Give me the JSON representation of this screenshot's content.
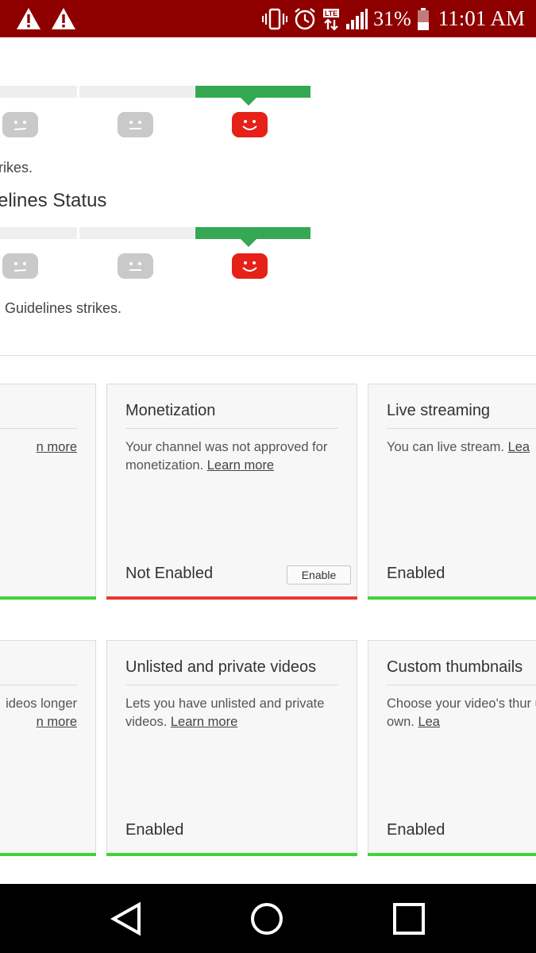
{
  "status_bar": {
    "icons": [
      "warning-icon",
      "warning-icon",
      "vibrate-icon",
      "alarm-icon",
      "lte-icon",
      "signal-icon",
      "battery-icon"
    ],
    "battery": "31%",
    "time": "11:01 AM",
    "background": "#8e0000"
  },
  "strikes": {
    "copyright_caption": "rikes.",
    "guidelines_title": "elines Status",
    "guidelines_caption": "Guidelines strikes."
  },
  "cards_row1": [
    {
      "title": "",
      "description": "",
      "link": "n more",
      "status": "",
      "status_color": "#3fd43a"
    },
    {
      "title": "Monetization",
      "description": "Your channel was not approved for monetization. ",
      "link": "Learn more",
      "status": "Not Enabled",
      "button": "Enable",
      "status_color": "#e53935"
    },
    {
      "title": "Live streaming",
      "description": "You can live stream. ",
      "link": "Lea",
      "status": "Enabled",
      "status_color": "#3fd43a"
    }
  ],
  "cards_row2": [
    {
      "title": "",
      "description": "ideos longer",
      "link": "n more",
      "status": "",
      "status_color": "#3fd43a"
    },
    {
      "title": "Unlisted and private videos",
      "description": "Lets you have unlisted and private videos. ",
      "link": "Learn more",
      "status": "Enabled",
      "status_color": "#3fd43a"
    },
    {
      "title": "Custom thumbnails",
      "description": "Choose your video's thur uploading your own. ",
      "link": "Lea",
      "status": "Enabled",
      "status_color": "#3fd43a"
    }
  ],
  "navigation": {
    "icons": [
      "back-icon",
      "home-icon",
      "recents-icon"
    ]
  },
  "colors": {
    "accent_green": "#34a853",
    "strike_red": "#e62117",
    "enabled_green": "#3fd43a",
    "not_enabled_red": "#e53935"
  }
}
